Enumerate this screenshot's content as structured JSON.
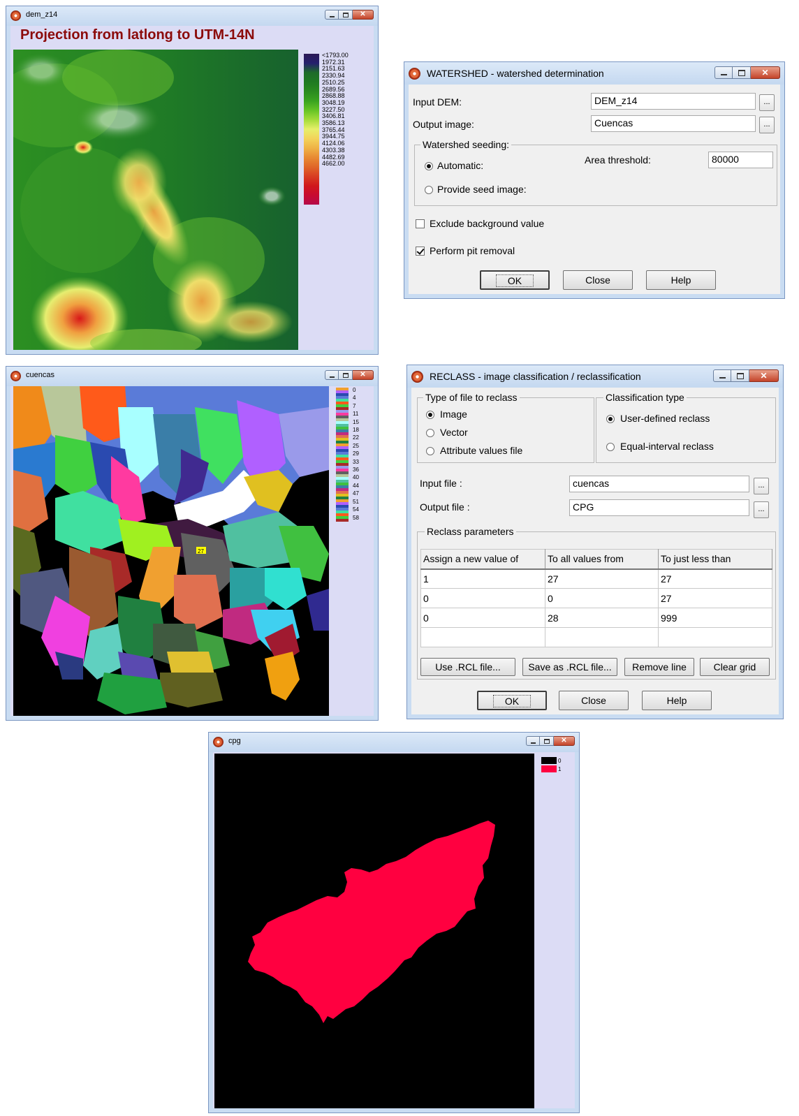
{
  "dem_window": {
    "title": "dem_z14",
    "map_title": "Projection from latlong to UTM-14N",
    "legend": [
      "<1793.00",
      "1972.31",
      "2151.63",
      "2330.94",
      "2510.25",
      "2689.56",
      "2868.88",
      "3048.19",
      "3227.50",
      "3406.81",
      "3586.13",
      "3765.44",
      "3944.75",
      "4124.06",
      "4303.38",
      "4482.69",
      "4662.00"
    ],
    "legend_colors": [
      "#2b1a55",
      "#241f6e",
      "#1d6b2a",
      "#1f7a22",
      "#2a8b1f",
      "#3aa31f",
      "#66c425",
      "#a4dc3a",
      "#e6ef6a",
      "#f3d35a",
      "#efb246",
      "#e88a33",
      "#e06628",
      "#d83d22",
      "#d0181c",
      "#c80a30",
      "#b40a4a"
    ]
  },
  "watershed_dialog": {
    "title": "WATERSHED - watershed determination",
    "input_dem_label": "Input DEM:",
    "input_dem_value": "DEM_z14",
    "output_image_label": "Output image:",
    "output_image_value": "Cuencas",
    "browse_label": "...",
    "seeding_group": "Watershed seeding:",
    "automatic_label": "Automatic:",
    "provide_seed_label": "Provide seed image:",
    "area_threshold_label": "Area threshold:",
    "area_threshold_value": "80000",
    "exclude_bg_label": "Exclude background value",
    "pit_removal_label": "Perform pit removal",
    "exclude_bg_checked": false,
    "pit_removal_checked": true,
    "ok_label": "OK",
    "close_label": "Close",
    "help_label": "Help"
  },
  "cuencas_window": {
    "title": "cuencas",
    "selected_label": "27",
    "legend": [
      "0",
      "4",
      "7",
      "11",
      "15",
      "18",
      "22",
      "25",
      "29",
      "33",
      "36",
      "40",
      "44",
      "47",
      "51",
      "54",
      "58"
    ]
  },
  "reclass_dialog": {
    "title": "RECLASS - image classification / reclassification",
    "type_group": "Type of file to reclass",
    "type_options": [
      "Image",
      "Vector",
      "Attribute values file"
    ],
    "type_selected": 0,
    "class_group": "Classification type",
    "class_options": [
      "User-defined reclass",
      "Equal-interval reclass"
    ],
    "class_selected": 0,
    "input_file_label": "Input file :",
    "input_file_value": "cuencas",
    "output_file_label": "Output file :",
    "output_file_value": "CPG",
    "browse_label": "...",
    "params_group": "Reclass parameters",
    "grid_headers": [
      "Assign a new value of",
      "To all values from",
      "To just less than"
    ],
    "grid_rows": [
      [
        "1",
        "27",
        "27"
      ],
      [
        "0",
        "0",
        "27"
      ],
      [
        "0",
        "28",
        "999"
      ],
      [
        "",
        "",
        ""
      ]
    ],
    "use_rcl_label": "Use .RCL file...",
    "save_rcl_label": "Save as .RCL file...",
    "remove_line_label": "Remove line",
    "clear_grid_label": "Clear grid",
    "ok_label": "OK",
    "close_label": "Close",
    "help_label": "Help"
  },
  "cpg_window": {
    "title": "cpg",
    "legend": [
      {
        "label": "0",
        "color": "#000000"
      },
      {
        "label": "1",
        "color": "#ff0040"
      }
    ]
  }
}
